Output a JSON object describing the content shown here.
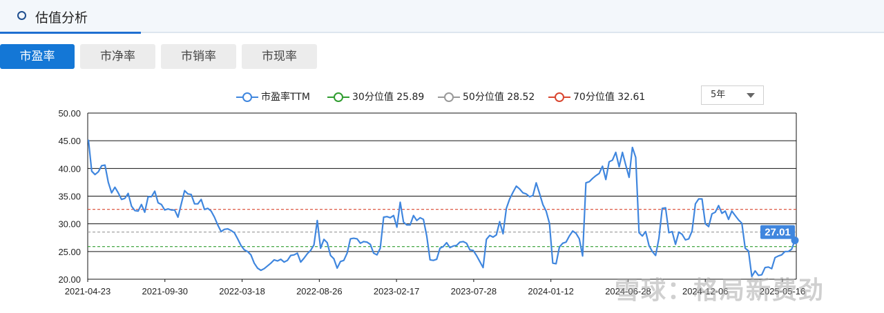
{
  "header": {
    "title": "估值分析"
  },
  "tabs": [
    {
      "label": "市盈率",
      "active": true
    },
    {
      "label": "市净率",
      "active": false
    },
    {
      "label": "市销率",
      "active": false
    },
    {
      "label": "市现率",
      "active": false
    }
  ],
  "range_select": {
    "value": "5年"
  },
  "watermark": "雪球：格局新费劲",
  "chart_data": {
    "type": "line",
    "xlabel": "",
    "ylabel": "",
    "ylim": [
      20,
      50
    ],
    "yticks": [
      "50.00",
      "45.00",
      "40.00",
      "35.00",
      "30.00",
      "25.00",
      "20.00"
    ],
    "xticks": [
      "2021-04-23",
      "2021-09-30",
      "2022-03-18",
      "2022-08-26",
      "2023-02-17",
      "2023-07-28",
      "2024-01-12",
      "2024-06-28",
      "2024-12-06",
      "2025-05-16"
    ],
    "grid": true,
    "legend_position": "top",
    "series": [
      {
        "name": "市盈率TTM",
        "color": "#3f86de",
        "last_value_label": "27.01",
        "values": [
          45.2,
          39.5,
          38.9,
          39.4,
          40.5,
          40.6,
          37.5,
          35.6,
          36.6,
          35.6,
          34.4,
          34.6,
          35.5,
          33.2,
          32.4,
          32.3,
          33.5,
          32.1,
          34.9,
          34.9,
          35.9,
          33.8,
          33.5,
          32.5,
          32.7,
          32.5,
          32.5,
          31.2,
          33.6,
          36.0,
          35.4,
          35.3,
          33.6,
          33.6,
          34.4,
          32.6,
          32.8,
          32.3,
          31.2,
          29.8,
          28.6,
          29.0,
          29.1,
          28.8,
          28.4,
          27.3,
          26.1,
          25.3,
          25.0,
          24.4,
          22.9,
          22.0,
          21.6,
          21.9,
          22.4,
          22.9,
          23.5,
          23.3,
          23.6,
          23.1,
          23.4,
          24.3,
          24.4,
          24.7,
          23.1,
          23.8,
          24.6,
          25.2,
          26.2,
          30.6,
          25.6,
          27.2,
          26.6,
          24.3,
          23.7,
          22.0,
          23.2,
          23.4,
          24.7,
          27.3,
          27.4,
          27.3,
          26.5,
          26.8,
          26.7,
          26.3,
          24.7,
          24.4,
          25.6,
          31.2,
          31.3,
          31.1,
          31.5,
          29.4,
          33.9,
          30.3,
          29.8,
          29.8,
          31.5,
          30.6,
          31.1,
          30.8,
          27.8,
          23.5,
          23.4,
          23.6,
          25.6,
          25.9,
          26.6,
          25.7,
          26.0,
          26.1,
          26.7,
          26.8,
          26.5,
          25.3,
          25.2,
          24.3,
          23.2,
          22.1,
          27.2,
          27.9,
          27.6,
          28.0,
          30.4,
          28.2,
          32.8,
          34.5,
          35.7,
          36.8,
          36.3,
          35.6,
          35.4,
          34.9,
          35.1,
          37.4,
          35.5,
          33.5,
          32.3,
          30.1,
          22.9,
          22.8,
          25.8,
          26.5,
          26.7,
          27.8,
          28.7,
          28.3,
          27.3,
          24.2,
          37.4,
          37.6,
          38.2,
          38.7,
          39.1,
          40.4,
          38.0,
          41.2,
          41.5,
          42.9,
          40.3,
          42.9,
          40.6,
          38.4,
          43.8,
          42.0,
          28.4,
          27.8,
          28.6,
          26.1,
          25.0,
          24.3,
          27.4,
          32.8,
          32.9,
          28.4,
          28.6,
          26.3,
          28.5,
          28.1,
          27.1,
          27.3,
          28.7,
          33.6,
          34.5,
          34.5,
          30.0,
          29.5,
          31.8,
          32.1,
          33.3,
          31.9,
          32.3,
          30.8,
          32.3,
          31.5,
          30.7,
          30.1,
          25.6,
          25.1,
          20.5,
          21.5,
          20.7,
          20.8,
          22.1,
          22.2,
          21.9,
          23.9,
          24.2,
          24.4,
          25.0,
          25.0,
          25.4,
          27.01
        ]
      },
      {
        "name": "30分位值 25.89",
        "color": "#2f9c2f",
        "value": 25.89
      },
      {
        "name": "50分位值 28.52",
        "color": "#999999",
        "value": 28.52
      },
      {
        "name": "70分位值 32.61",
        "color": "#d9452f",
        "value": 32.61
      }
    ]
  }
}
